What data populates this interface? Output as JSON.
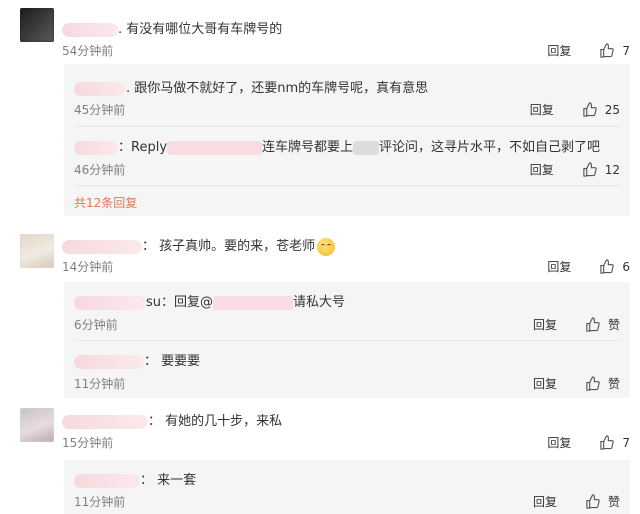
{
  "comments": [
    {
      "text": "有没有哪位大哥有车牌号的",
      "time": "54分钟前",
      "reply_label": "回复",
      "likes": "7",
      "replies": [
        {
          "text": "跟你马做不就好了，还要nm的车牌号呢，真有意思",
          "time": "45分钟前",
          "reply_label": "回复",
          "likes": "25"
        },
        {
          "text_a": "Reply",
          "text_b": "连车牌号都要上",
          "text_c": "评论问，这寻片水平，不如自己剥了吧",
          "time": "46分钟前",
          "reply_label": "回复",
          "likes": "12"
        }
      ],
      "more": "共12条回复"
    },
    {
      "text": "孩子真帅。要的来，苍老师",
      "time": "14分钟前",
      "reply_label": "回复",
      "likes": "6",
      "replies": [
        {
          "text_a": "su：回复@",
          "text_b": "请私大号",
          "time": "6分钟前",
          "reply_label": "回复",
          "likes": "赞"
        },
        {
          "text": "要要要",
          "time": "11分钟前",
          "reply_label": "回复",
          "likes": "赞"
        }
      ]
    },
    {
      "text": "有她的几十步，来私",
      "time": "15分钟前",
      "reply_label": "回复",
      "likes": "7",
      "replies": [
        {
          "text": "来一套",
          "time": "11分钟前",
          "reply_label": "回复",
          "likes": "赞"
        }
      ]
    }
  ]
}
